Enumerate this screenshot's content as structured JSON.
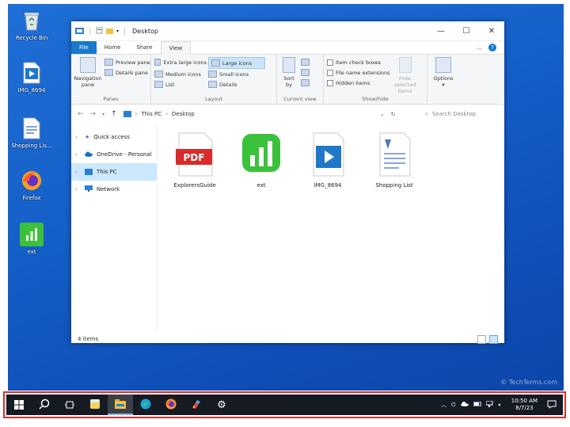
{
  "desktop": {
    "icons": [
      {
        "label": "Recycle Bin",
        "icon": "recycle-bin-icon"
      },
      {
        "label": "IMG_8694",
        "icon": "video-file-icon"
      },
      {
        "label": "Shopping Lis...",
        "icon": "document-icon"
      },
      {
        "label": "Firefox",
        "icon": "firefox-icon"
      },
      {
        "label": "ext",
        "icon": "numbers-app-icon"
      }
    ],
    "watermark": "© TechTerms.com"
  },
  "explorer": {
    "title": "Desktop",
    "tabs": [
      "File",
      "Home",
      "Share",
      "View"
    ],
    "ribbon": {
      "panes": {
        "name": "Panes",
        "navigation_pane": "Navigation pane",
        "preview_pane": "Preview pane",
        "details_pane": "Details pane"
      },
      "layout": {
        "name": "Layout",
        "items": [
          "Extra large icons",
          "Large icons",
          "Medium icons",
          "Small icons",
          "List",
          "Details"
        ],
        "selected": "Large icons"
      },
      "current_view": {
        "name": "Current view",
        "sort_by": "Sort by"
      },
      "show_hide": {
        "name": "Show/hide",
        "item_check_boxes": "Item check boxes",
        "file_name_extensions": "File name extensions",
        "hidden_items": "Hidden items",
        "hide_selected_items": "Hide selected items"
      },
      "options": {
        "label": "Options"
      }
    },
    "address": {
      "breadcrumb": [
        "This PC",
        "Desktop"
      ],
      "search_placeholder": "Search Desktop"
    },
    "nav": [
      {
        "label": "Quick access",
        "icon": "star-icon"
      },
      {
        "label": "OneDrive - Personal",
        "icon": "cloud-icon"
      },
      {
        "label": "This PC",
        "icon": "computer-icon",
        "active": true
      },
      {
        "label": "Network",
        "icon": "network-icon"
      }
    ],
    "files": [
      {
        "name": "ExplorersGuide",
        "icon": "pdf-file-icon",
        "badge": "PDF"
      },
      {
        "name": "ext",
        "icon": "numbers-app-icon"
      },
      {
        "name": "IMG_8694",
        "icon": "video-file-icon"
      },
      {
        "name": "Shopping List",
        "icon": "text-document-icon"
      }
    ],
    "status": "4 items"
  },
  "taskbar": {
    "clock_time": "10:50 AM",
    "clock_date": "8/7/23",
    "items": [
      "start-icon",
      "search-icon",
      "task-view-icon",
      "notes-app-icon",
      "file-explorer-icon",
      "edge-icon",
      "firefox-icon",
      "paint-app-icon",
      "settings-icon"
    ]
  },
  "colors": {
    "accent": "#1979ca",
    "taskbar": "#161a22",
    "highlight_border": "#d9302c",
    "numbers_green": "#3cc13b",
    "pdf_red": "#d92b2b"
  }
}
